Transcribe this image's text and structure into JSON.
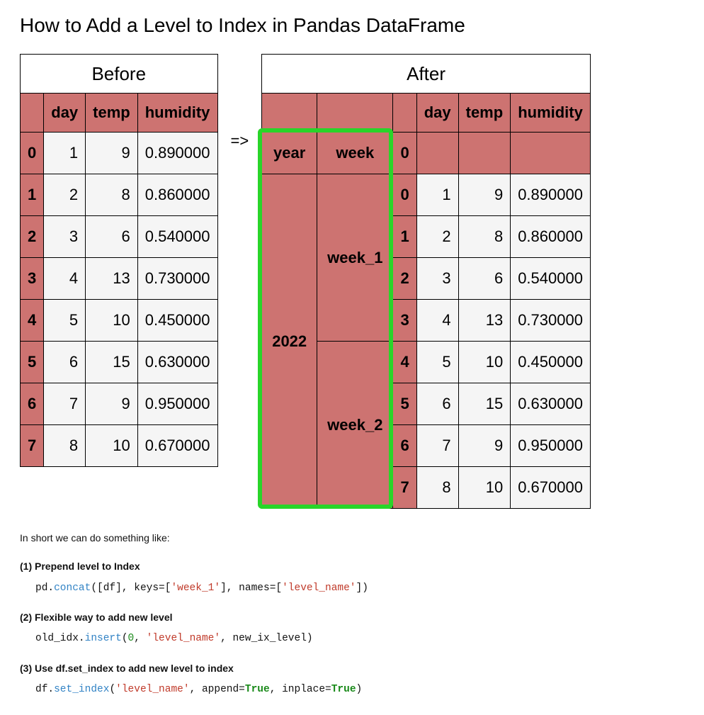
{
  "title": "How to Add a Level to Index in Pandas DataFrame",
  "arrow": "=>",
  "before": {
    "caption": "Before",
    "columns": [
      "day",
      "temp",
      "humidity"
    ],
    "rows": [
      {
        "i": "0",
        "day": "1",
        "temp": "9",
        "humidity": "0.890000"
      },
      {
        "i": "1",
        "day": "2",
        "temp": "8",
        "humidity": "0.860000"
      },
      {
        "i": "2",
        "day": "3",
        "temp": "6",
        "humidity": "0.540000"
      },
      {
        "i": "3",
        "day": "4",
        "temp": "13",
        "humidity": "0.730000"
      },
      {
        "i": "4",
        "day": "5",
        "temp": "10",
        "humidity": "0.450000"
      },
      {
        "i": "5",
        "day": "6",
        "temp": "15",
        "humidity": "0.630000"
      },
      {
        "i": "6",
        "day": "7",
        "temp": "9",
        "humidity": "0.950000"
      },
      {
        "i": "7",
        "day": "8",
        "temp": "10",
        "humidity": "0.670000"
      }
    ]
  },
  "after": {
    "caption": "After",
    "columns": [
      "day",
      "temp",
      "humidity"
    ],
    "index_names": [
      "year",
      "week"
    ],
    "top_inner": "0",
    "year": "2022",
    "weeks": [
      "week_1",
      "week_2"
    ],
    "rows": [
      {
        "i": "0",
        "day": "1",
        "temp": "9",
        "humidity": "0.890000"
      },
      {
        "i": "1",
        "day": "2",
        "temp": "8",
        "humidity": "0.860000"
      },
      {
        "i": "2",
        "day": "3",
        "temp": "6",
        "humidity": "0.540000"
      },
      {
        "i": "3",
        "day": "4",
        "temp": "13",
        "humidity": "0.730000"
      },
      {
        "i": "4",
        "day": "5",
        "temp": "10",
        "humidity": "0.450000"
      },
      {
        "i": "5",
        "day": "6",
        "temp": "15",
        "humidity": "0.630000"
      },
      {
        "i": "6",
        "day": "7",
        "temp": "9",
        "humidity": "0.950000"
      },
      {
        "i": "7",
        "day": "8",
        "temp": "10",
        "humidity": "0.670000"
      }
    ]
  },
  "notes": {
    "intro": "In short we can do something like:",
    "step1_title": "(1) Prepend level to Index",
    "step2_title": "(2) Flexible way to add new level",
    "step3_title": "(3) Use df.set_index to add new level to index",
    "code1": {
      "pre": "pd.",
      "fn": "concat",
      "mid": "([df], keys=[",
      "s1": "'week_1'",
      "mid2": "], names=[",
      "s2": "'level_name'",
      "end": "])"
    },
    "code2": {
      "pre": "old_idx.",
      "fn": "insert",
      "mid": "(",
      "n": "0",
      "mid2": ", ",
      "s": "'level_name'",
      "end": ", new_ix_level)"
    },
    "code3": {
      "pre": "df.",
      "fn": "set_index",
      "mid": "(",
      "s": "'level_name'",
      "mid2": ", append=",
      "kw1": "True",
      "mid3": ", inplace=",
      "kw2": "True",
      "end": ")"
    }
  }
}
